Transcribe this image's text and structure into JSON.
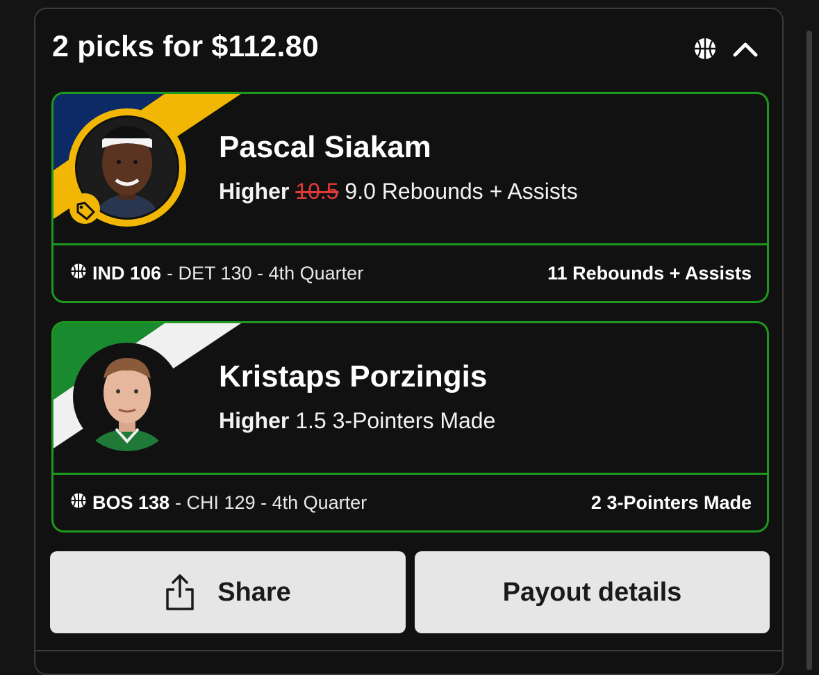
{
  "header": {
    "title": "2 picks for $112.80",
    "sport_icon": "basketball-icon",
    "toggle_icon": "chevron-up-icon"
  },
  "picks": [
    {
      "player": "Pascal Siakam",
      "direction": "Higher",
      "original_line": "10.5",
      "line": "9.0",
      "stat": "Rebounds + Assists",
      "team_a": "IND 106",
      "rest": "- DET 130 - 4th Quarter",
      "result": "11 Rebounds + Assists",
      "badge_icon": "tag-icon",
      "colors": {
        "ring": "#f2b705",
        "stripe_a": "#0c2a66",
        "stripe_b": "#f2b705"
      }
    },
    {
      "player": "Kristaps Porzingis",
      "direction": "Higher",
      "line": "1.5",
      "stat": "3-Pointers Made",
      "team_a": "BOS 138",
      "rest": "- CHI 129 - 4th Quarter",
      "result": "2 3-Pointers Made",
      "colors": {
        "stripe_a": "#1a8a2e",
        "stripe_b": "#f0f0f0"
      }
    }
  ],
  "actions": {
    "share": "Share",
    "payout": "Payout details"
  },
  "colors": {
    "accent_green": "#1d9a1d",
    "strike_red": "#e23a3a"
  }
}
